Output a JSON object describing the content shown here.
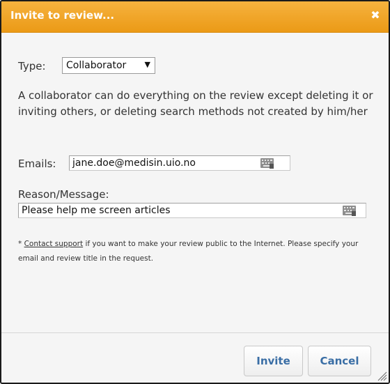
{
  "dialog": {
    "title": "Invite to review...",
    "close_glyph": "✖"
  },
  "type_row": {
    "label": "Type:",
    "selected": "Collaborator",
    "arrow_glyph": "▼"
  },
  "description": "A collaborator can do everything on the review except deleting it or inviting others, or deleting search methods not created by him/her",
  "emails": {
    "label": "Emails:",
    "value": "jane.doe@medisin.uio.no"
  },
  "reason": {
    "label": "Reason/Message:",
    "value": "Please help me screen articles"
  },
  "note": {
    "prefix": "* ",
    "link": "Contact support",
    "text": " if you want to make your review public to the Internet. Please specify your email and review title in the request."
  },
  "buttons": {
    "invite": "Invite",
    "cancel": "Cancel"
  },
  "colors": {
    "titlebar": "#eb9a16",
    "button_text": "#3a6ea5",
    "background": "#f5f5f5"
  },
  "icons": {
    "close": "close-icon",
    "keyboard": "virtual-keyboard-icon",
    "dropdown": "chevron-down-icon",
    "resize": "resize-grip-icon"
  }
}
